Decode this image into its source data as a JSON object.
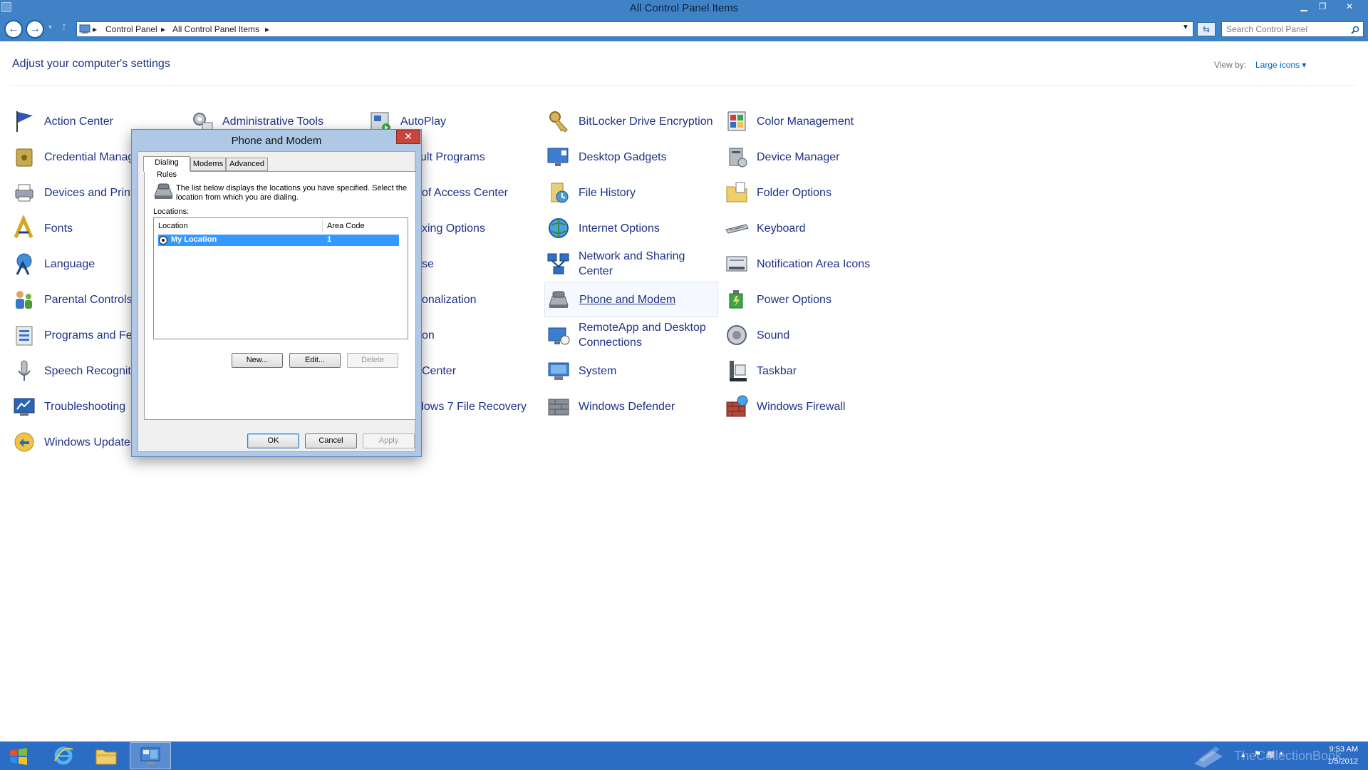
{
  "window": {
    "title": "All Control Panel Items",
    "buttons": {
      "minimize": "▁",
      "restore": "❐",
      "close": "✕"
    }
  },
  "address_bar": {
    "breadcrumbs": [
      "Control Panel",
      "All Control Panel Items"
    ],
    "separator": "▸",
    "search_placeholder": "Search Control Panel"
  },
  "content": {
    "heading": "Adjust your computer's settings",
    "view_by_label": "View by:",
    "view_by_value": "Large icons ▾"
  },
  "items": {
    "action_center": "Action Center",
    "administrative_tools": "Administrative Tools",
    "autoplay": "AutoPlay",
    "bitlocker": "BitLocker Drive Encryption",
    "color_management": "Color Management",
    "credential_manager": "Credential Manag",
    "default_programs": "ult Programs",
    "desktop_gadgets": "Desktop Gadgets",
    "device_manager": "Device Manager",
    "devices_printers": "Devices and Print",
    "ease_of_access": "of Access Center",
    "file_history": "File History",
    "folder_options": "Folder Options",
    "fonts": "Fonts",
    "indexing_options": "xing Options",
    "internet_options": "Internet Options",
    "keyboard": "Keyboard",
    "language": "Language",
    "mouse": "se",
    "network_sharing_1": "Network and Sharing",
    "network_sharing_2": "Center",
    "notification_area": "Notification Area Icons",
    "parental_controls": "Parental Controls",
    "personalization": "onalization",
    "phone_modem": "Phone and Modem",
    "power_options": "Power Options",
    "programs_features": "Programs and Fe",
    "recovery": "on",
    "remoteapp_1": "RemoteApp and Desktop",
    "remoteapp_2": "Connections",
    "sound": "Sound",
    "speech_recognition": "Speech Recogniti",
    "sync_center": "Center",
    "system": "System",
    "taskbar": "Taskbar",
    "troubleshooting": "Troubleshooting",
    "win7_recovery": "dows 7 File Recovery",
    "windows_defender": "Windows Defender",
    "windows_firewall": "Windows Firewall",
    "windows_update": "Windows Update"
  },
  "dialog": {
    "title": "Phone and Modem",
    "close": "✕",
    "tabs": [
      "Dialing Rules",
      "Modems",
      "Advanced"
    ],
    "description": "The list below displays the locations you have specified. Select the location from which you are dialing.",
    "locations_label": "Locations:",
    "columns": [
      "Location",
      "Area Code"
    ],
    "rows": [
      {
        "location": "My Location",
        "area_code": "1",
        "selected": true
      }
    ],
    "buttons": {
      "new": "New...",
      "edit": "Edit...",
      "delete": "Delete",
      "ok": "OK",
      "cancel": "Cancel",
      "apply": "Apply"
    }
  },
  "taskbar": {
    "apps": [
      "internet-explorer-icon",
      "file-explorer-icon",
      "control-panel-icon"
    ],
    "watermark": "TheCollectionBook",
    "time": "9:53 AM",
    "date": "1/5/2012"
  },
  "colors": {
    "title_bar": "#3f82c5",
    "taskbar": "#2b6cc4",
    "link_text": "#1e3287",
    "selection": "#3399ff"
  }
}
